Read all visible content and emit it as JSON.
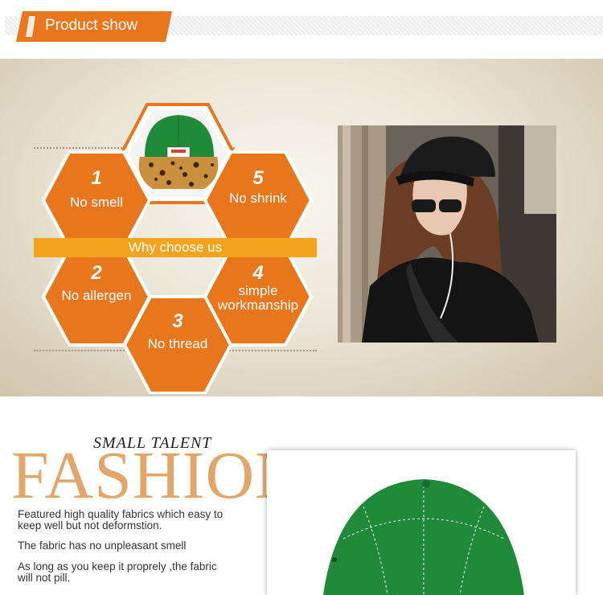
{
  "header": {
    "title": "Product show"
  },
  "features": {
    "center_label": "Why choose us",
    "items": [
      {
        "num": "1",
        "label": "No smell"
      },
      {
        "num": "5",
        "label": "No shrink"
      },
      {
        "num": "2",
        "label": "No allergen"
      },
      {
        "num": "4",
        "label_line1": "simple",
        "label_line2": "workmanship"
      },
      {
        "num": "3",
        "label": "No thread"
      }
    ]
  },
  "fashion": {
    "small_title": "SMALL TALENT",
    "big_title": "FASHION",
    "paragraphs": [
      {
        "line1": "Featured high quality fabrics which easy to",
        "line2": "keep well but not deformstion."
      },
      {
        "line1": "The fabric has no unpleasant smell"
      },
      {
        "line1": "As long as you keep it proprely ,the fabric",
        "line2": "will not pill."
      }
    ]
  },
  "colors": {
    "accent": "#e8761d",
    "strip": "#f2a41e",
    "cap_green": "#1f8a3a"
  }
}
